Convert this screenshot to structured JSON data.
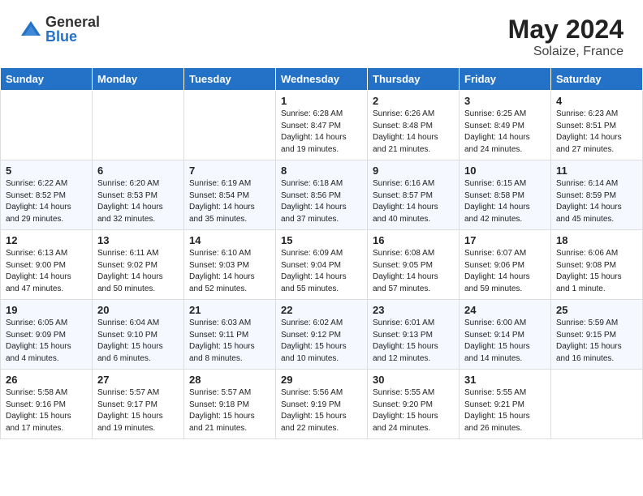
{
  "header": {
    "logo_general": "General",
    "logo_blue": "Blue",
    "month_year": "May 2024",
    "location": "Solaize, France"
  },
  "weekdays": [
    "Sunday",
    "Monday",
    "Tuesday",
    "Wednesday",
    "Thursday",
    "Friday",
    "Saturday"
  ],
  "weeks": [
    [
      {
        "day": "",
        "sunrise": "",
        "sunset": "",
        "daylight": ""
      },
      {
        "day": "",
        "sunrise": "",
        "sunset": "",
        "daylight": ""
      },
      {
        "day": "",
        "sunrise": "",
        "sunset": "",
        "daylight": ""
      },
      {
        "day": "1",
        "sunrise": "Sunrise: 6:28 AM",
        "sunset": "Sunset: 8:47 PM",
        "daylight": "Daylight: 14 hours and 19 minutes."
      },
      {
        "day": "2",
        "sunrise": "Sunrise: 6:26 AM",
        "sunset": "Sunset: 8:48 PM",
        "daylight": "Daylight: 14 hours and 21 minutes."
      },
      {
        "day": "3",
        "sunrise": "Sunrise: 6:25 AM",
        "sunset": "Sunset: 8:49 PM",
        "daylight": "Daylight: 14 hours and 24 minutes."
      },
      {
        "day": "4",
        "sunrise": "Sunrise: 6:23 AM",
        "sunset": "Sunset: 8:51 PM",
        "daylight": "Daylight: 14 hours and 27 minutes."
      }
    ],
    [
      {
        "day": "5",
        "sunrise": "Sunrise: 6:22 AM",
        "sunset": "Sunset: 8:52 PM",
        "daylight": "Daylight: 14 hours and 29 minutes."
      },
      {
        "day": "6",
        "sunrise": "Sunrise: 6:20 AM",
        "sunset": "Sunset: 8:53 PM",
        "daylight": "Daylight: 14 hours and 32 minutes."
      },
      {
        "day": "7",
        "sunrise": "Sunrise: 6:19 AM",
        "sunset": "Sunset: 8:54 PM",
        "daylight": "Daylight: 14 hours and 35 minutes."
      },
      {
        "day": "8",
        "sunrise": "Sunrise: 6:18 AM",
        "sunset": "Sunset: 8:56 PM",
        "daylight": "Daylight: 14 hours and 37 minutes."
      },
      {
        "day": "9",
        "sunrise": "Sunrise: 6:16 AM",
        "sunset": "Sunset: 8:57 PM",
        "daylight": "Daylight: 14 hours and 40 minutes."
      },
      {
        "day": "10",
        "sunrise": "Sunrise: 6:15 AM",
        "sunset": "Sunset: 8:58 PM",
        "daylight": "Daylight: 14 hours and 42 minutes."
      },
      {
        "day": "11",
        "sunrise": "Sunrise: 6:14 AM",
        "sunset": "Sunset: 8:59 PM",
        "daylight": "Daylight: 14 hours and 45 minutes."
      }
    ],
    [
      {
        "day": "12",
        "sunrise": "Sunrise: 6:13 AM",
        "sunset": "Sunset: 9:00 PM",
        "daylight": "Daylight: 14 hours and 47 minutes."
      },
      {
        "day": "13",
        "sunrise": "Sunrise: 6:11 AM",
        "sunset": "Sunset: 9:02 PM",
        "daylight": "Daylight: 14 hours and 50 minutes."
      },
      {
        "day": "14",
        "sunrise": "Sunrise: 6:10 AM",
        "sunset": "Sunset: 9:03 PM",
        "daylight": "Daylight: 14 hours and 52 minutes."
      },
      {
        "day": "15",
        "sunrise": "Sunrise: 6:09 AM",
        "sunset": "Sunset: 9:04 PM",
        "daylight": "Daylight: 14 hours and 55 minutes."
      },
      {
        "day": "16",
        "sunrise": "Sunrise: 6:08 AM",
        "sunset": "Sunset: 9:05 PM",
        "daylight": "Daylight: 14 hours and 57 minutes."
      },
      {
        "day": "17",
        "sunrise": "Sunrise: 6:07 AM",
        "sunset": "Sunset: 9:06 PM",
        "daylight": "Daylight: 14 hours and 59 minutes."
      },
      {
        "day": "18",
        "sunrise": "Sunrise: 6:06 AM",
        "sunset": "Sunset: 9:08 PM",
        "daylight": "Daylight: 15 hours and 1 minute."
      }
    ],
    [
      {
        "day": "19",
        "sunrise": "Sunrise: 6:05 AM",
        "sunset": "Sunset: 9:09 PM",
        "daylight": "Daylight: 15 hours and 4 minutes."
      },
      {
        "day": "20",
        "sunrise": "Sunrise: 6:04 AM",
        "sunset": "Sunset: 9:10 PM",
        "daylight": "Daylight: 15 hours and 6 minutes."
      },
      {
        "day": "21",
        "sunrise": "Sunrise: 6:03 AM",
        "sunset": "Sunset: 9:11 PM",
        "daylight": "Daylight: 15 hours and 8 minutes."
      },
      {
        "day": "22",
        "sunrise": "Sunrise: 6:02 AM",
        "sunset": "Sunset: 9:12 PM",
        "daylight": "Daylight: 15 hours and 10 minutes."
      },
      {
        "day": "23",
        "sunrise": "Sunrise: 6:01 AM",
        "sunset": "Sunset: 9:13 PM",
        "daylight": "Daylight: 15 hours and 12 minutes."
      },
      {
        "day": "24",
        "sunrise": "Sunrise: 6:00 AM",
        "sunset": "Sunset: 9:14 PM",
        "daylight": "Daylight: 15 hours and 14 minutes."
      },
      {
        "day": "25",
        "sunrise": "Sunrise: 5:59 AM",
        "sunset": "Sunset: 9:15 PM",
        "daylight": "Daylight: 15 hours and 16 minutes."
      }
    ],
    [
      {
        "day": "26",
        "sunrise": "Sunrise: 5:58 AM",
        "sunset": "Sunset: 9:16 PM",
        "daylight": "Daylight: 15 hours and 17 minutes."
      },
      {
        "day": "27",
        "sunrise": "Sunrise: 5:57 AM",
        "sunset": "Sunset: 9:17 PM",
        "daylight": "Daylight: 15 hours and 19 minutes."
      },
      {
        "day": "28",
        "sunrise": "Sunrise: 5:57 AM",
        "sunset": "Sunset: 9:18 PM",
        "daylight": "Daylight: 15 hours and 21 minutes."
      },
      {
        "day": "29",
        "sunrise": "Sunrise: 5:56 AM",
        "sunset": "Sunset: 9:19 PM",
        "daylight": "Daylight: 15 hours and 22 minutes."
      },
      {
        "day": "30",
        "sunrise": "Sunrise: 5:55 AM",
        "sunset": "Sunset: 9:20 PM",
        "daylight": "Daylight: 15 hours and 24 minutes."
      },
      {
        "day": "31",
        "sunrise": "Sunrise: 5:55 AM",
        "sunset": "Sunset: 9:21 PM",
        "daylight": "Daylight: 15 hours and 26 minutes."
      },
      {
        "day": "",
        "sunrise": "",
        "sunset": "",
        "daylight": ""
      }
    ]
  ]
}
